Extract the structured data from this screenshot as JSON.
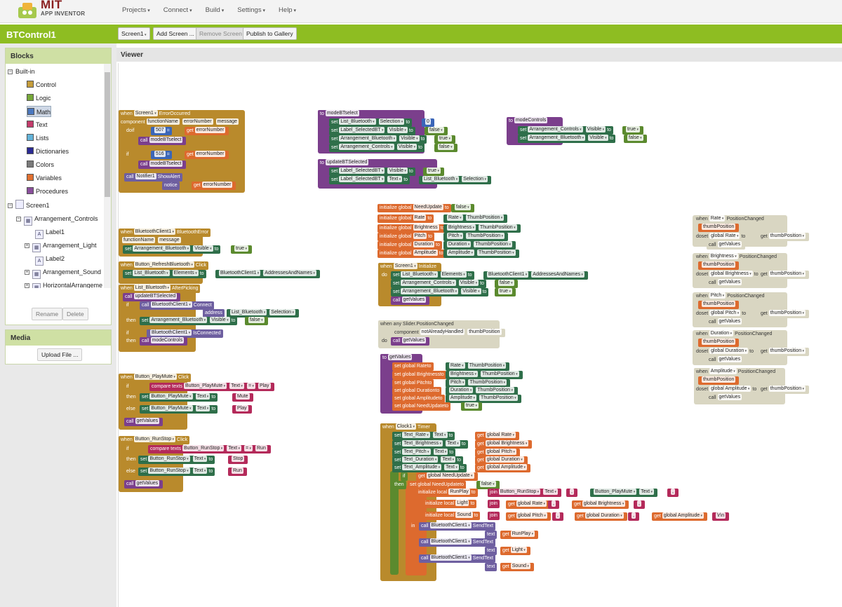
{
  "app": {
    "logo_top": "MIT",
    "logo_bottom": "APP INVENTOR",
    "menu": [
      "Projects",
      "Connect",
      "Build",
      "Settings",
      "Help"
    ]
  },
  "project": {
    "title": "BTControl1",
    "screen_select": "Screen1",
    "add_screen": "Add Screen ...",
    "remove_screen": "Remove Screen",
    "publish": "Publish to Gallery"
  },
  "blocks_panel": {
    "title": "Blocks",
    "builtin": "Built-in",
    "items": [
      {
        "label": "Control",
        "color": "#c59c3a"
      },
      {
        "label": "Logic",
        "color": "#77a83a"
      },
      {
        "label": "Math",
        "color": "#4a78c0"
      },
      {
        "label": "Text",
        "color": "#c23b6a"
      },
      {
        "label": "Lists",
        "color": "#63b3d8"
      },
      {
        "label": "Dictionaries",
        "color": "#2a2a93"
      },
      {
        "label": "Colors",
        "color": "#7a7a7a"
      },
      {
        "label": "Variables",
        "color": "#e07030"
      },
      {
        "label": "Procedures",
        "color": "#8a4f9c"
      }
    ],
    "screen": "Screen1",
    "components": [
      "Arrangement_Controls",
      "Label1",
      "Arrangement_Light",
      "Label2",
      "Arrangement_Sound",
      "HorizontalArrangeme"
    ],
    "rename": "Rename",
    "delete": "Delete"
  },
  "media": {
    "title": "Media",
    "upload": "Upload File ..."
  },
  "viewer": {
    "title": "Viewer"
  },
  "blocks": {
    "when": "when",
    "do": "do",
    "set": "set",
    "to": "to",
    "call": "call",
    "get": "get",
    "if": "if",
    "then": "then",
    "else": "else",
    "in": "in",
    "text": "text",
    "notice": "notice",
    "join": "join",
    "eq": "=",
    "Screen1": "Screen1",
    "ErrorOccurred": "ErrorOccurred",
    "component": "component",
    "functionName": "functionName",
    "errorNumber": "errorNumber",
    "message": "message",
    "n507": "507",
    "n516": "516",
    "modeBTselect": "modeBTselect",
    "Notifier1": "Notifier1",
    "ShowAlert": "ShowAlert",
    "BluetoothClient1": "BluetoothClient1",
    "BluetoothError": "BluetoothError",
    "Arrangement_Bluetooth": "Arrangement_Bluetooth",
    "Visible": "Visible",
    "true": "true",
    "false": "false",
    "Button_RefreshBluetooth": "Button_RefreshBluetooth",
    "Click": "Click",
    "List_Bluetooth": "List_Bluetooth",
    "Elements": "Elements",
    "AddressesAndNames": "AddressesAndNames",
    "AfterPicking": "AfterPicking",
    "updateBTSelected": "updateBTSelected",
    "Connect": "Connect",
    "address": "address",
    "Selection": "Selection",
    "IsConnected": "IsConnected",
    "modeControls": "modeControls",
    "Button_PlayMute": "Button_PlayMute",
    "compare_texts": "compare texts",
    "Text": "Text",
    "Play": "Play",
    "Mute": "Mute",
    "getValues": "getValues",
    "Button_RunStop": "Button_RunStop",
    "Run": "Run",
    "Stop": "Stop",
    "n0": "0",
    "Label_SelectedBT": "Label_SelectedBT",
    "Arrangement_Controls": "Arrangement_Controls",
    "init_global": "initialize global",
    "NeedUpdate": "NeedUpdate",
    "Rate": "Rate",
    "Brightness": "Brightness",
    "Pitch": "Pitch",
    "Duration": "Duration",
    "Amplitude": "Amplitude",
    "ThumbPosition": "ThumbPosition",
    "Initialize": "Initialize",
    "when_any_slider": "when any Slider.PositionChanged",
    "notAlreadyHandled": "notAlreadyHandled",
    "thumbPosition": "thumbPosition",
    "set_global_Rate": "set global Rate",
    "set_global_Brightness": "set global Brightness",
    "set_global_Pitch": "set global Pitch",
    "set_global_Duration": "set global Duration",
    "set_global_Amplitude": "set global Amplitude",
    "set_global_NeedUpdate": "set global NeedUpdate",
    "PositionChanged": "PositionChanged",
    "global_Rate": "global Rate",
    "global_Brightness": "global Brightness",
    "global_Pitch": "global Pitch",
    "global_Duration": "global Duration",
    "global_Amplitude": "global Amplitude",
    "global_NeedUpdate": "global NeedUpdate",
    "Clock1": "Clock1",
    "Timer": "Timer",
    "Text_Rate": "Text_Rate",
    "Text_Brightness": "Text_Brightness",
    "Text_Pitch": "Text_Pitch",
    "Text_Duration": "Text_Duration",
    "Text_Amplitude": "Text_Amplitude",
    "init_local": "initialize local",
    "RunPlay": "RunPlay",
    "Light": "Light",
    "Sound": "Sound",
    "SendText": "SendText",
    "comma": ",",
    "crlf": "\\r\\n"
  }
}
